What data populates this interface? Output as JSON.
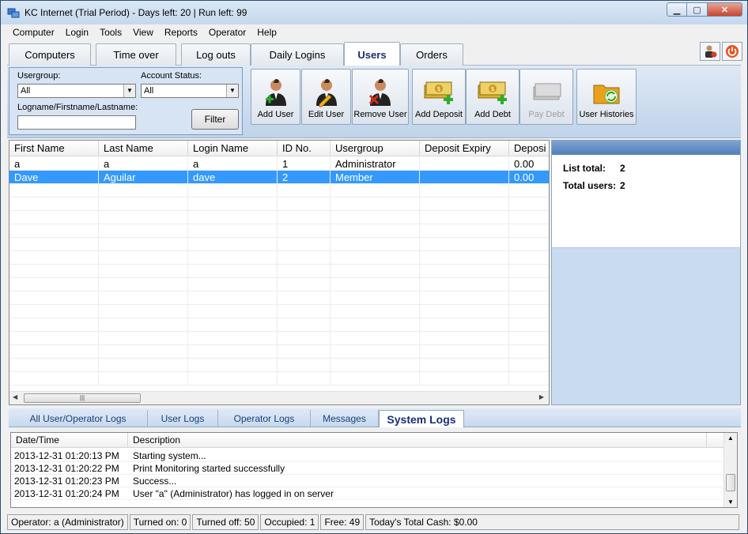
{
  "window": {
    "title": "KC Internet (Trial Period) - Days left: 20 | Run left: 99"
  },
  "menu": [
    "Computer",
    "Login",
    "Tools",
    "View",
    "Reports",
    "Operator",
    "Help"
  ],
  "tabs": [
    "Computers",
    "Time over",
    "Log outs",
    "Daily Logins",
    "Users",
    "Orders"
  ],
  "active_tab": "Users",
  "filter": {
    "usergroup_label": "Usergroup:",
    "usergroup_value": "All",
    "account_status_label": "Account Status:",
    "account_status_value": "All",
    "name_label": "Logname/Firstname/Lastname:",
    "name_value": "",
    "filter_button": "Filter"
  },
  "toolbar": [
    {
      "label": "Add User",
      "icon": "add-user-icon",
      "enabled": true
    },
    {
      "label": "Edit User",
      "icon": "edit-user-icon",
      "enabled": true
    },
    {
      "label": "Remove User",
      "icon": "remove-user-icon",
      "enabled": true
    },
    {
      "label": "Add Deposit",
      "icon": "add-deposit-icon",
      "enabled": true
    },
    {
      "label": "Add Debt",
      "icon": "add-debt-icon",
      "enabled": true
    },
    {
      "label": "Pay Debt",
      "icon": "pay-debt-icon",
      "enabled": false
    },
    {
      "label": "User Histories",
      "icon": "user-histories-icon",
      "enabled": true
    }
  ],
  "users_table": {
    "columns": [
      "First Name",
      "Last Name",
      "Login Name",
      "ID No.",
      "Usergroup",
      "Deposit Expiry",
      "Deposi"
    ],
    "rows": [
      [
        "a",
        "a",
        "a",
        "1",
        "Administrator",
        "",
        "0.00"
      ],
      [
        "Dave",
        "Aguilar",
        "dave",
        "2",
        "Member",
        "",
        "0.00"
      ]
    ],
    "selected_row": 1
  },
  "summary": {
    "list_total_label": "List total:",
    "list_total_value": "2",
    "total_users_label": "Total users:",
    "total_users_value": "2"
  },
  "log_tabs": [
    "All User/Operator Logs",
    "User Logs",
    "Operator Logs",
    "Messages",
    "System Logs"
  ],
  "active_log_tab": "System Logs",
  "logs": {
    "columns": [
      "Date/Time",
      "Description"
    ],
    "rows": [
      [
        "2013-12-31 01:20:13 PM",
        "Starting system..."
      ],
      [
        "2013-12-31 01:20:22 PM",
        "Print Monitoring started successfully"
      ],
      [
        "2013-12-31 01:20:23 PM",
        "Success..."
      ],
      [
        "2013-12-31 01:20:24 PM",
        "User \"a\" (Administrator) has logged in on server"
      ]
    ]
  },
  "status": {
    "operator": "Operator: a (Administrator)",
    "turned_on": "Turned on: 0",
    "turned_off": "Turned off: 50",
    "occupied": "Occupied: 1",
    "free": "Free: 49",
    "cash": "Today's Total Cash: $0.00"
  }
}
